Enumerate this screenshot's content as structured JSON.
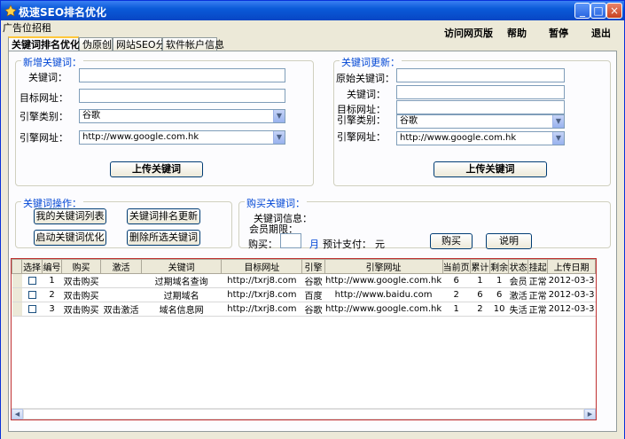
{
  "window": {
    "title": "极速SEO排名优化",
    "ad_label": "广告位招租"
  },
  "topmenu": {
    "visit": "访问网页版",
    "help": "帮助",
    "pause": "暂停",
    "exit": "退出"
  },
  "tabs": [
    "关键词排名优化",
    "伪原创",
    "网站SEO分析",
    "软件帐户信息"
  ],
  "add_group": {
    "legend": "新增关键词：",
    "keyword_label": "关键词：",
    "url_label": "目标网址：",
    "engine_type_label": "引擎类别：",
    "engine_type_value": "谷歌",
    "engine_url_label": "引擎网址：",
    "engine_url_value": "http://www.google.com.hk",
    "upload_button": "上传关键词"
  },
  "update_group": {
    "legend": "关键词更新：",
    "orig_keyword_label": "原始关键词：",
    "keyword_label": "关键词：",
    "url_label": "目标网址：",
    "engine_type_label": "引擎类别：",
    "engine_type_value": "谷歌",
    "engine_url_label": "引擎网址：",
    "engine_url_value": "http://www.google.com.hk",
    "upload_button": "上传关键词"
  },
  "ops_group": {
    "legend": "关键词操作：",
    "my_list": "我的关键词列表",
    "rank_update": "关键词排名更新",
    "start_opt": "启动关键词优化",
    "delete_sel": "删除所选关键词"
  },
  "buy_group": {
    "legend": "购买关键词：",
    "info_label": "关键词信息：",
    "member_label": "会员期限：",
    "buy_label": "购买：",
    "month_unit": "月",
    "pay_label": "预计支付：",
    "yuan_unit": "元",
    "buy_button": "购买",
    "explain_button": "说明"
  },
  "table": {
    "columns": [
      "选择",
      "编号",
      "购买",
      "激活",
      "关键词",
      "目标网址",
      "引擎",
      "引擎网址",
      "当前页",
      "累计",
      "剩余",
      "状态",
      "挂起",
      "上传日期"
    ],
    "rows": [
      {
        "id": "1",
        "buy": "双击购买",
        "activate": "",
        "keyword": "过期域名查询",
        "url": "http://txrj8.com",
        "engine": "谷歌",
        "engine_url": "http://www.google.com.hk",
        "page": "6",
        "total": "1",
        "left": "1",
        "status": "会员",
        "hang": "正常",
        "date": "2012-03-3"
      },
      {
        "id": "2",
        "buy": "双击购买",
        "activate": "",
        "keyword": "过期域名",
        "url": "http://txrj8.com",
        "engine": "百度",
        "engine_url": "http://www.baidu.com",
        "page": "2",
        "total": "6",
        "left": "6",
        "status": "激活",
        "hang": "正常",
        "date": "2012-03-3"
      },
      {
        "id": "3",
        "buy": "双击购买",
        "activate": "双击激活",
        "keyword": "域名信息网",
        "url": "http://txrj8.com",
        "engine": "谷歌",
        "engine_url": "http://www.google.com.hk",
        "page": "1",
        "total": "2",
        "left": "10",
        "status": "失活",
        "hang": "正常",
        "date": "2012-03-3"
      }
    ]
  }
}
